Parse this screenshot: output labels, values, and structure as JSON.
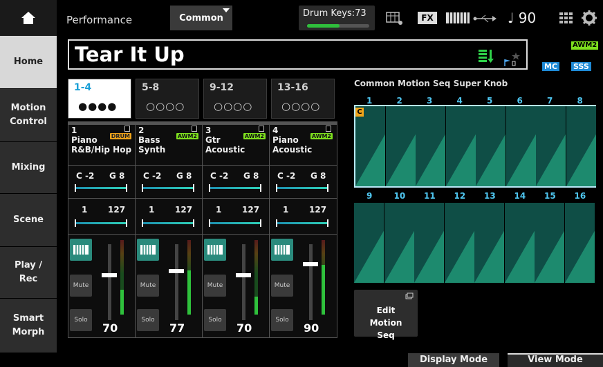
{
  "header": {
    "section": "Performance",
    "tab": "Common",
    "drum_keys": "Drum Keys:73",
    "fx_label": "FX",
    "tempo": "♩ 90"
  },
  "sidebar": {
    "items": [
      {
        "label": "Home"
      },
      {
        "label": "Motion Control"
      },
      {
        "label": "Mixing"
      },
      {
        "label": "Scene"
      },
      {
        "label": "Play / Rec"
      },
      {
        "label": "Smart Morph"
      }
    ]
  },
  "performance": {
    "name": "Tear It Up",
    "badges": [
      "AWM2",
      "MC",
      "SSS"
    ]
  },
  "part_tabs": [
    {
      "label": "1-4",
      "dots": "●●●●"
    },
    {
      "label": "5-8",
      "dots": "○○○○"
    },
    {
      "label": "9-12",
      "dots": "○○○○"
    },
    {
      "label": "13-16",
      "dots": "○○○○"
    }
  ],
  "parts": [
    {
      "num": "1",
      "line1": "Piano",
      "line2": "R&B/Hip Hop",
      "badge": "DRUM",
      "note_lo": "C -2",
      "note_hi": "G 8",
      "vel_lo": "1",
      "vel_hi": "127",
      "kbd": "keyboard-icon",
      "mute": "Mute",
      "solo": "Solo",
      "volume": "70"
    },
    {
      "num": "2",
      "line1": "Bass",
      "line2": "Synth",
      "badge": "AWM2",
      "note_lo": "C -2",
      "note_hi": "G 8",
      "vel_lo": "1",
      "vel_hi": "127",
      "kbd": "keyboard-icon",
      "mute": "Mute",
      "solo": "Solo",
      "volume": "77"
    },
    {
      "num": "3",
      "line1": "Gtr",
      "line2": "Acoustic",
      "badge": "AWM2",
      "note_lo": "C -2",
      "note_hi": "G 8",
      "vel_lo": "1",
      "vel_hi": "127",
      "kbd": "keyboard-icon",
      "mute": "Mute",
      "solo": "Solo",
      "volume": "70"
    },
    {
      "num": "4",
      "line1": "Piano",
      "line2": "Acoustic",
      "badge": "AWM2",
      "note_lo": "C -2",
      "note_hi": "G 8",
      "vel_lo": "1",
      "vel_hi": "127",
      "kbd": "keyboard-icon",
      "mute": "Mute",
      "solo": "Solo",
      "volume": "90"
    }
  ],
  "motion_seq": {
    "title": "Common Motion Seq Super Knob",
    "lanes_top": [
      "1",
      "2",
      "3",
      "4",
      "5",
      "6",
      "7",
      "8"
    ],
    "lanes_bottom": [
      "9",
      "10",
      "11",
      "12",
      "13",
      "14",
      "15",
      "16"
    ],
    "marker": "C",
    "edit_button": "Edit Motion Seq"
  },
  "footer": {
    "display_mode": "Display Mode",
    "view_mode": "View Mode"
  },
  "colors": {
    "accent_blue": "#1a9fd6",
    "seq_green": "#0f4e46",
    "awm_green": "#7ee01e",
    "drum_orange": "#f0a41a"
  }
}
